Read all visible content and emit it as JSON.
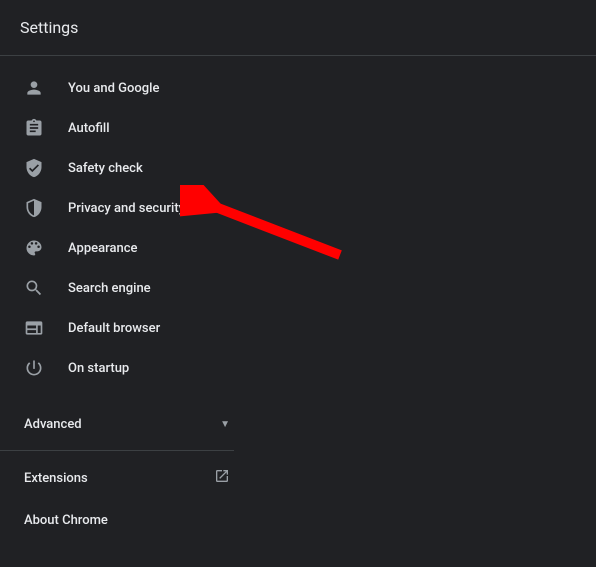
{
  "header": {
    "title": "Settings"
  },
  "nav": {
    "items": [
      {
        "label": "You and Google"
      },
      {
        "label": "Autofill"
      },
      {
        "label": "Safety check"
      },
      {
        "label": "Privacy and security"
      },
      {
        "label": "Appearance"
      },
      {
        "label": "Search engine"
      },
      {
        "label": "Default browser"
      },
      {
        "label": "On startup"
      }
    ]
  },
  "advanced": {
    "label": "Advanced"
  },
  "extensions": {
    "label": "Extensions"
  },
  "about": {
    "label": "About Chrome"
  },
  "annotation": {
    "arrow_color": "#ff0000"
  }
}
